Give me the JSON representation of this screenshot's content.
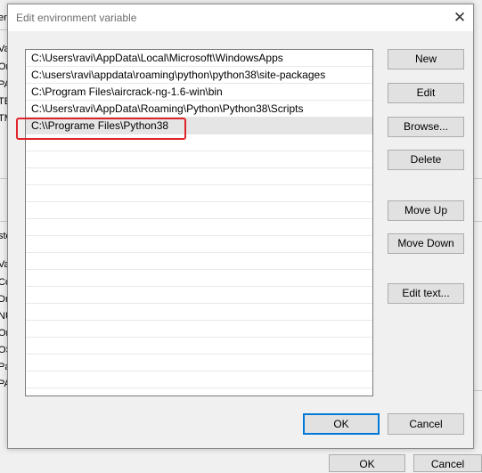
{
  "background": {
    "left_fragments": [
      "er",
      "Va",
      "Or",
      "PA",
      "TE",
      "TM",
      "ste",
      "Va",
      "Co",
      "Dr",
      "NU",
      "Or",
      "OS",
      "Pa",
      "PA"
    ],
    "bottom_buttons": [
      "OK",
      "Cancel"
    ]
  },
  "dialog": {
    "title": "Edit environment variable",
    "close_glyph": "✕",
    "paths": [
      "C:\\Users\\ravi\\AppData\\Local\\Microsoft\\WindowsApps",
      "C:\\users\\ravi\\appdata\\roaming\\python\\python38\\site-packages",
      "C:\\Program Files\\aircrack-ng-1.6-win\\bin",
      "C:\\Users\\ravi\\AppData\\Roaming\\Python\\Python38\\Scripts",
      "C:\\\\Programe Files\\Python38"
    ],
    "selected_index": 4,
    "highlight_color": "#e0242b",
    "buttons": {
      "new": "New",
      "edit": "Edit",
      "browse": "Browse...",
      "delete": "Delete",
      "move_up": "Move Up",
      "move_down": "Move Down",
      "edit_text": "Edit text..."
    },
    "ok": "OK",
    "cancel": "Cancel"
  }
}
